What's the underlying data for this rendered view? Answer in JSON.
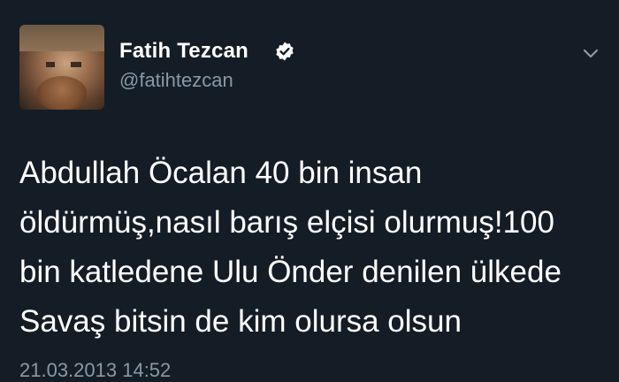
{
  "tweet": {
    "display_name": "Fatih Tezcan",
    "handle": "@fatihtezcan",
    "verified": true,
    "body_lines": [
      "Abdullah Öcalan 40 bin insan",
      "öldürmüş,nasıl barış elçisi olurmuş!100",
      "bin katledene Ulu Önder denilen ülkede",
      "Savaş bitsin de kim olursa olsun"
    ],
    "timestamp": "21.03.2013 14:52"
  },
  "icons": {
    "verified": "verified-badge-icon",
    "menu": "chevron-down-icon"
  },
  "colors": {
    "background": "#141d26",
    "primary_text": "#ffffff",
    "secondary_text": "#8899a6"
  }
}
